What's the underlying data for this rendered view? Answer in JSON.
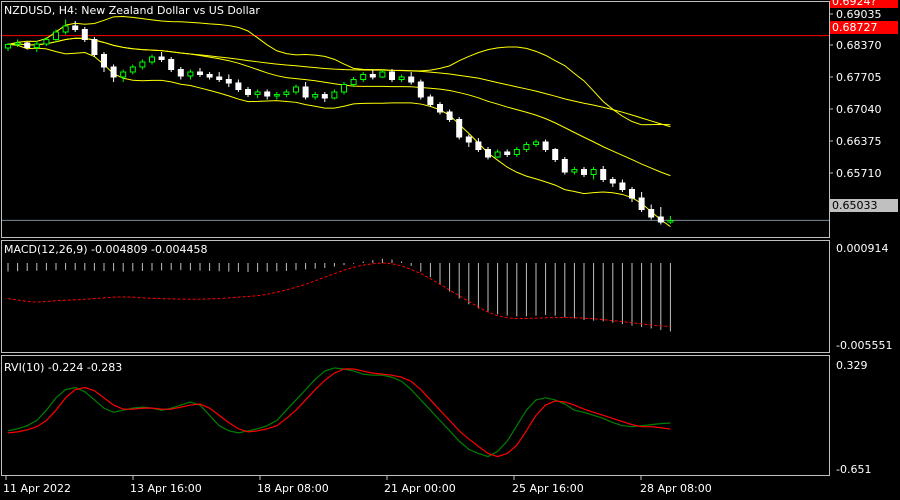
{
  "header": {
    "symbol": "NZDUSD, H4:",
    "description": "New Zealand Dollar vs US Dollar"
  },
  "price_axis": {
    "ticks": [
      "0.69035",
      "0.68370",
      "0.67705",
      "0.67040",
      "0.66375",
      "0.65710"
    ],
    "top_badge": "0.6924?",
    "red_line_badge": "0.68727",
    "current_badge": "0.65033"
  },
  "macd": {
    "label": "MACD(12,26,9) -0.004809 -0.004458",
    "axis_top": "0.000914",
    "axis_bottom": "-0.005551"
  },
  "rvi": {
    "label": "RVI(10) -0.224 -0.283",
    "axis_top": "0.329",
    "axis_bottom": "-0.651"
  },
  "time_axis": [
    "11 Apr 2022",
    "13 Apr 16:00",
    "18 Apr 08:00",
    "21 Apr 00:00",
    "25 Apr 16:00",
    "28 Apr 08:00"
  ],
  "colors": {
    "background": "#000000",
    "grid": "#c0c0c0",
    "bull": "#00ff00",
    "bear": "#ffffff",
    "bands": "#ffff00",
    "red_line": "#ff0000",
    "macd_signal": "#ff0000",
    "rvi_main": "#008000",
    "rvi_signal": "#ff0000",
    "badge_red": "#ff0000",
    "current_price_line": "#778899"
  },
  "chart_data": {
    "type": "candlestick",
    "price_levels": {
      "red_line": 0.68727,
      "current": 0.65033,
      "ylim": [
        0.647,
        0.694
      ]
    },
    "candles": [
      [
        0.6848,
        0.6858,
        0.6842,
        0.6855
      ],
      [
        0.6855,
        0.6865,
        0.685,
        0.6858
      ],
      [
        0.6858,
        0.686,
        0.6845,
        0.6849
      ],
      [
        0.6849,
        0.6862,
        0.684,
        0.6856
      ],
      [
        0.6856,
        0.687,
        0.6852,
        0.6865
      ],
      [
        0.6865,
        0.6885,
        0.686,
        0.688
      ],
      [
        0.688,
        0.6905,
        0.6875,
        0.6892
      ],
      [
        0.6892,
        0.6902,
        0.688,
        0.6885
      ],
      [
        0.6885,
        0.689,
        0.686,
        0.6865
      ],
      [
        0.6865,
        0.687,
        0.683,
        0.6835
      ],
      [
        0.6835,
        0.684,
        0.68,
        0.681
      ],
      [
        0.681,
        0.6815,
        0.678,
        0.679
      ],
      [
        0.679,
        0.6805,
        0.678,
        0.68
      ],
      [
        0.68,
        0.6815,
        0.6795,
        0.681
      ],
      [
        0.681,
        0.6825,
        0.6805,
        0.682
      ],
      [
        0.682,
        0.6835,
        0.6815,
        0.683
      ],
      [
        0.683,
        0.684,
        0.682,
        0.6825
      ],
      [
        0.6825,
        0.683,
        0.68,
        0.6805
      ],
      [
        0.6805,
        0.681,
        0.6785,
        0.6792
      ],
      [
        0.6792,
        0.6805,
        0.6785,
        0.68
      ],
      [
        0.68,
        0.6808,
        0.679,
        0.6795
      ],
      [
        0.6795,
        0.68,
        0.6785,
        0.679
      ],
      [
        0.679,
        0.68,
        0.678,
        0.6785
      ],
      [
        0.6785,
        0.6795,
        0.677,
        0.6778
      ],
      [
        0.6778,
        0.6785,
        0.676,
        0.6765
      ],
      [
        0.6765,
        0.677,
        0.675,
        0.6755
      ],
      [
        0.6755,
        0.6765,
        0.6748,
        0.676
      ],
      [
        0.676,
        0.6765,
        0.6745,
        0.6752
      ],
      [
        0.6752,
        0.676,
        0.6745,
        0.6755
      ],
      [
        0.6755,
        0.6765,
        0.675,
        0.676
      ],
      [
        0.676,
        0.6775,
        0.6755,
        0.677
      ],
      [
        0.677,
        0.678,
        0.6745,
        0.675
      ],
      [
        0.675,
        0.676,
        0.6745,
        0.6755
      ],
      [
        0.6755,
        0.676,
        0.674,
        0.6748
      ],
      [
        0.6748,
        0.6765,
        0.6745,
        0.676
      ],
      [
        0.676,
        0.678,
        0.6755,
        0.6775
      ],
      [
        0.6775,
        0.679,
        0.677,
        0.6785
      ],
      [
        0.6785,
        0.68,
        0.678,
        0.6795
      ],
      [
        0.6795,
        0.6805,
        0.6785,
        0.679
      ],
      [
        0.679,
        0.6805,
        0.6788,
        0.68
      ],
      [
        0.68,
        0.6806,
        0.678,
        0.6785
      ],
      [
        0.6785,
        0.6795,
        0.678,
        0.679
      ],
      [
        0.679,
        0.68,
        0.6775,
        0.678
      ],
      [
        0.678,
        0.6785,
        0.6745,
        0.675
      ],
      [
        0.675,
        0.6755,
        0.673,
        0.6735
      ],
      [
        0.6735,
        0.674,
        0.6715,
        0.672
      ],
      [
        0.672,
        0.6725,
        0.67,
        0.6705
      ],
      [
        0.6705,
        0.671,
        0.6665,
        0.667
      ],
      [
        0.667,
        0.6675,
        0.665,
        0.666
      ],
      [
        0.666,
        0.6668,
        0.664,
        0.6645
      ],
      [
        0.6645,
        0.665,
        0.6625,
        0.663
      ],
      [
        0.663,
        0.6645,
        0.6628,
        0.664
      ],
      [
        0.664,
        0.6645,
        0.663,
        0.6635
      ],
      [
        0.6635,
        0.665,
        0.663,
        0.6645
      ],
      [
        0.6645,
        0.666,
        0.664,
        0.6655
      ],
      [
        0.6655,
        0.6665,
        0.665,
        0.666
      ],
      [
        0.666,
        0.6665,
        0.664,
        0.6645
      ],
      [
        0.6645,
        0.6648,
        0.662,
        0.6625
      ],
      [
        0.6625,
        0.663,
        0.6595,
        0.66
      ],
      [
        0.66,
        0.661,
        0.6595,
        0.6605
      ],
      [
        0.6605,
        0.661,
        0.659,
        0.6595
      ],
      [
        0.6595,
        0.661,
        0.6585,
        0.6605
      ],
      [
        0.6605,
        0.6612,
        0.658,
        0.6585
      ],
      [
        0.6585,
        0.659,
        0.657,
        0.6578
      ],
      [
        0.6578,
        0.6585,
        0.656,
        0.6565
      ],
      [
        0.6565,
        0.657,
        0.654,
        0.6548
      ],
      [
        0.6548,
        0.656,
        0.652,
        0.6525
      ],
      [
        0.6525,
        0.6535,
        0.6505,
        0.651
      ],
      [
        0.651,
        0.653,
        0.6495,
        0.65
      ],
      [
        0.65,
        0.6512,
        0.6496,
        0.6503
      ]
    ],
    "macd_hist": [
      -0.0006,
      -0.00058,
      -0.00056,
      -0.00054,
      -0.00052,
      -0.0005,
      -0.00048,
      -0.0005,
      -0.00052,
      -0.00054,
      -0.00056,
      -0.00058,
      -0.0006,
      -0.00058,
      -0.00056,
      -0.00054,
      -0.00052,
      -0.0005,
      -0.0005,
      -0.00052,
      -0.00054,
      -0.00056,
      -0.00058,
      -0.0006,
      -0.00062,
      -0.00064,
      -0.00062,
      -0.0006,
      -0.00058,
      -0.00056,
      -0.0005,
      -0.00045,
      -0.0004,
      -0.00035,
      -0.00025,
      -0.00015,
      -5e-05,
      0.0001,
      0.0002,
      0.0003,
      0.00025,
      0.0001,
      -0.0002,
      -0.0006,
      -0.001,
      -0.0015,
      -0.002,
      -0.0025,
      -0.0029,
      -0.0032,
      -0.0034,
      -0.0036,
      -0.0037,
      -0.00375,
      -0.00375,
      -0.0037,
      -0.00365,
      -0.0037,
      -0.0038,
      -0.0039,
      -0.004,
      -0.00405,
      -0.0041,
      -0.0042,
      -0.0043,
      -0.0044,
      -0.0045,
      -0.0046,
      -0.0047,
      -0.00481
    ],
    "macd_signal": [
      -0.0025,
      -0.0026,
      -0.0027,
      -0.00275,
      -0.0027,
      -0.00265,
      -0.00262,
      -0.00258,
      -0.00255,
      -0.0025,
      -0.00245,
      -0.0024,
      -0.00238,
      -0.0024,
      -0.00245,
      -0.00248,
      -0.0025,
      -0.00252,
      -0.00254,
      -0.00255,
      -0.00254,
      -0.00252,
      -0.0025,
      -0.00245,
      -0.0024,
      -0.00235,
      -0.0023,
      -0.0022,
      -0.00205,
      -0.0019,
      -0.0017,
      -0.0015,
      -0.00125,
      -0.001,
      -0.00075,
      -0.0005,
      -0.0003,
      -0.00015,
      -5e-05,
      0.0,
      -5e-05,
      -0.0002,
      -0.00045,
      -0.00075,
      -0.0011,
      -0.0015,
      -0.0019,
      -0.0023,
      -0.0027,
      -0.0031,
      -0.00345,
      -0.0037,
      -0.00385,
      -0.0039,
      -0.0039,
      -0.00388,
      -0.00385,
      -0.00383,
      -0.00383,
      -0.00385,
      -0.00388,
      -0.00392,
      -0.00398,
      -0.00405,
      -0.00412,
      -0.0042,
      -0.00428,
      -0.00436,
      -0.00442,
      -0.00446
    ],
    "rvi_main": [
      -0.3,
      -0.28,
      -0.25,
      -0.2,
      -0.1,
      0.02,
      0.1,
      0.12,
      0.08,
      0.0,
      -0.08,
      -0.12,
      -0.1,
      -0.08,
      -0.07,
      -0.08,
      -0.1,
      -0.08,
      -0.05,
      -0.02,
      -0.05,
      -0.15,
      -0.25,
      -0.3,
      -0.32,
      -0.3,
      -0.28,
      -0.25,
      -0.2,
      -0.1,
      0.0,
      0.1,
      0.2,
      0.28,
      0.31,
      0.3,
      0.28,
      0.25,
      0.24,
      0.24,
      0.22,
      0.18,
      0.1,
      0.0,
      -0.1,
      -0.2,
      -0.3,
      -0.4,
      -0.48,
      -0.52,
      -0.55,
      -0.5,
      -0.4,
      -0.25,
      -0.1,
      0.0,
      0.02,
      0.0,
      -0.04,
      -0.1,
      -0.12,
      -0.15,
      -0.18,
      -0.22,
      -0.25,
      -0.26,
      -0.25,
      -0.24,
      -0.23,
      -0.224
    ],
    "rvi_signal": [
      -0.32,
      -0.31,
      -0.29,
      -0.26,
      -0.2,
      -0.1,
      0.02,
      0.1,
      0.12,
      0.09,
      0.02,
      -0.05,
      -0.09,
      -0.09,
      -0.08,
      -0.08,
      -0.09,
      -0.09,
      -0.07,
      -0.05,
      -0.04,
      -0.08,
      -0.15,
      -0.22,
      -0.28,
      -0.31,
      -0.3,
      -0.28,
      -0.25,
      -0.18,
      -0.1,
      0.0,
      0.1,
      0.19,
      0.26,
      0.3,
      0.3,
      0.28,
      0.26,
      0.25,
      0.24,
      0.22,
      0.18,
      0.1,
      0.0,
      -0.1,
      -0.2,
      -0.3,
      -0.38,
      -0.45,
      -0.52,
      -0.55,
      -0.52,
      -0.44,
      -0.3,
      -0.15,
      -0.05,
      -0.01,
      -0.02,
      -0.05,
      -0.09,
      -0.12,
      -0.15,
      -0.18,
      -0.21,
      -0.24,
      -0.26,
      -0.26,
      -0.27,
      -0.283
    ],
    "macd_ylim": [
      -0.005551,
      0.000914
    ],
    "rvi_ylim": [
      -0.651,
      0.329
    ]
  }
}
